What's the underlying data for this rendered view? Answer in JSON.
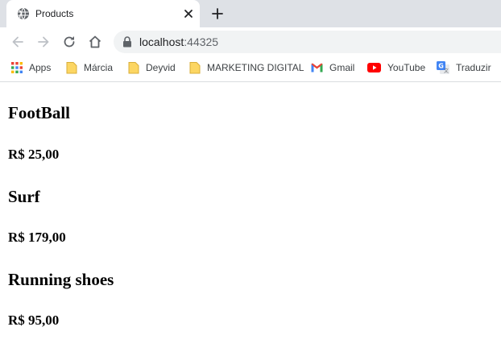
{
  "tab": {
    "title": "Products",
    "favicon": "globe-icon",
    "close_icon": "close-icon",
    "new_tab_icon": "plus-icon"
  },
  "toolbar": {
    "back_icon": "back-arrow-icon",
    "forward_icon": "forward-arrow-icon",
    "reload_icon": "reload-icon",
    "home_icon": "home-icon",
    "lock_icon": "lock-icon",
    "url_host": "localhost",
    "url_port": ":44325"
  },
  "bookmarks": {
    "items": [
      {
        "label": "Apps",
        "icon": "apps-grid-icon"
      },
      {
        "label": "Márcia",
        "icon": "folder-icon"
      },
      {
        "label": "Deyvid",
        "icon": "folder-icon"
      },
      {
        "label": "MARKETING DIGITAL",
        "icon": "folder-icon"
      },
      {
        "label": "Gmail",
        "icon": "gmail-icon"
      },
      {
        "label": "YouTube",
        "icon": "youtube-icon"
      },
      {
        "label": "Traduzir",
        "icon": "google-translate-icon"
      }
    ]
  },
  "products": [
    {
      "name": "FootBall",
      "price": "R$ 25,00"
    },
    {
      "name": "Surf",
      "price": "R$ 179,00"
    },
    {
      "name": "Running shoes",
      "price": "R$ 95,00"
    }
  ],
  "colors": {
    "tabstrip_bg": "#dee1e6",
    "omnibox_bg": "#f1f3f4",
    "folder_yellow": "#fcd663",
    "youtube_red": "#ff0000"
  }
}
